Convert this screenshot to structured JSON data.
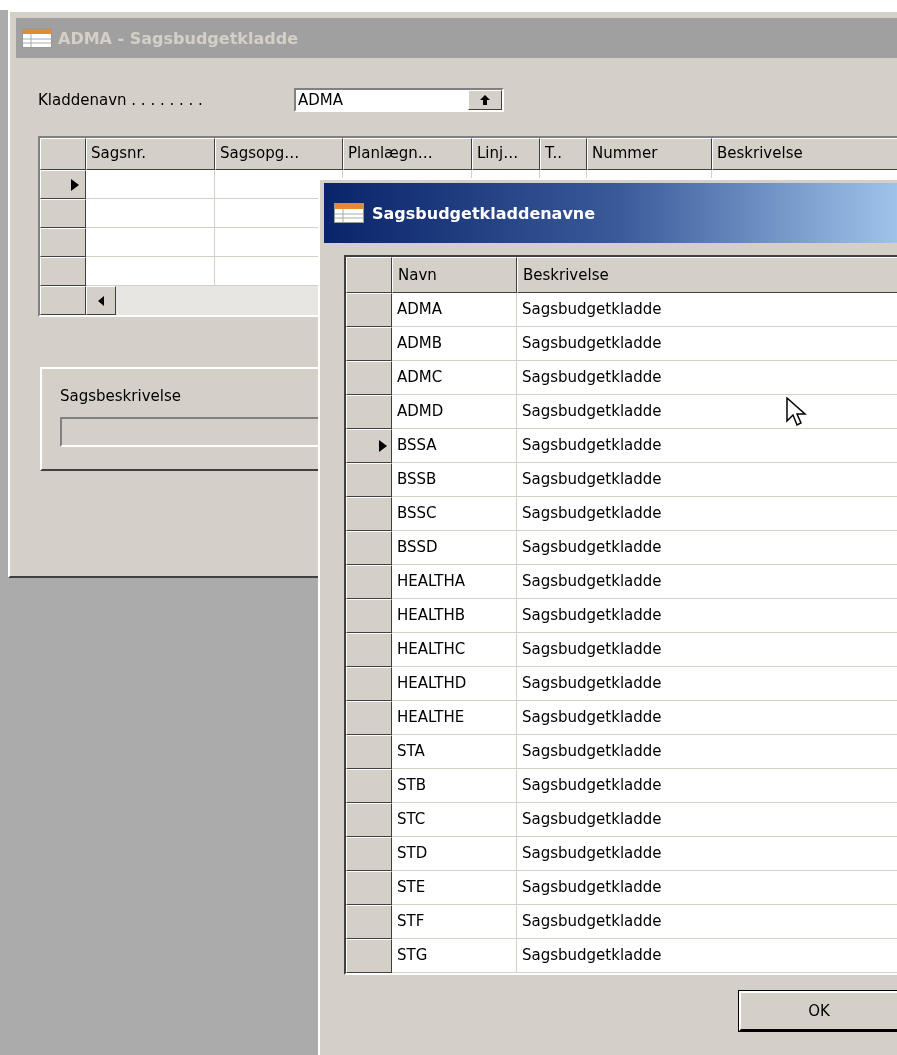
{
  "main_window": {
    "title": "ADMA - Sagsbudgetkladde",
    "active": false,
    "journal_field": {
      "label": "Kladdenavn . . . . . . . .",
      "value": "ADMA"
    },
    "table": {
      "columns": [
        "Sagsnr.",
        "Sagsopg…",
        "Planlægn…",
        "Linj…",
        "T..",
        "Nummer",
        "Beskrivelse"
      ],
      "rows": [
        {
          "selected": true
        },
        {
          "selected": false
        },
        {
          "selected": false
        },
        {
          "selected": false
        }
      ]
    },
    "description_group": {
      "label": "Sagsbeskrivelse"
    }
  },
  "dialog": {
    "title": "Sagsbudgetkladdenavne",
    "active": true,
    "table": {
      "columns": [
        "Navn",
        "Beskrivelse"
      ],
      "rows": [
        {
          "name": "ADMA",
          "description": "Sagsbudgetkladde",
          "selected": false
        },
        {
          "name": "ADMB",
          "description": "Sagsbudgetkladde",
          "selected": false
        },
        {
          "name": "ADMC",
          "description": "Sagsbudgetkladde",
          "selected": false
        },
        {
          "name": "ADMD",
          "description": "Sagsbudgetkladde",
          "selected": false
        },
        {
          "name": "BSSA",
          "description": "Sagsbudgetkladde",
          "selected": true
        },
        {
          "name": "BSSB",
          "description": "Sagsbudgetkladde",
          "selected": false
        },
        {
          "name": "BSSC",
          "description": "Sagsbudgetkladde",
          "selected": false
        },
        {
          "name": "BSSD",
          "description": "Sagsbudgetkladde",
          "selected": false
        },
        {
          "name": "HEALTHA",
          "description": "Sagsbudgetkladde",
          "selected": false
        },
        {
          "name": "HEALTHB",
          "description": "Sagsbudgetkladde",
          "selected": false
        },
        {
          "name": "HEALTHC",
          "description": "Sagsbudgetkladde",
          "selected": false
        },
        {
          "name": "HEALTHD",
          "description": "Sagsbudgetkladde",
          "selected": false
        },
        {
          "name": "HEALTHE",
          "description": "Sagsbudgetkladde",
          "selected": false
        },
        {
          "name": "STA",
          "description": "Sagsbudgetkladde",
          "selected": false
        },
        {
          "name": "STB",
          "description": "Sagsbudgetkladde",
          "selected": false
        },
        {
          "name": "STC",
          "description": "Sagsbudgetkladde",
          "selected": false
        },
        {
          "name": "STD",
          "description": "Sagsbudgetkladde",
          "selected": false
        },
        {
          "name": "STE",
          "description": "Sagsbudgetkladde",
          "selected": false
        },
        {
          "name": "STF",
          "description": "Sagsbudgetkladde",
          "selected": false
        },
        {
          "name": "STG",
          "description": "Sagsbudgetkladde",
          "selected": false
        }
      ]
    },
    "buttons": [
      "OK"
    ]
  }
}
